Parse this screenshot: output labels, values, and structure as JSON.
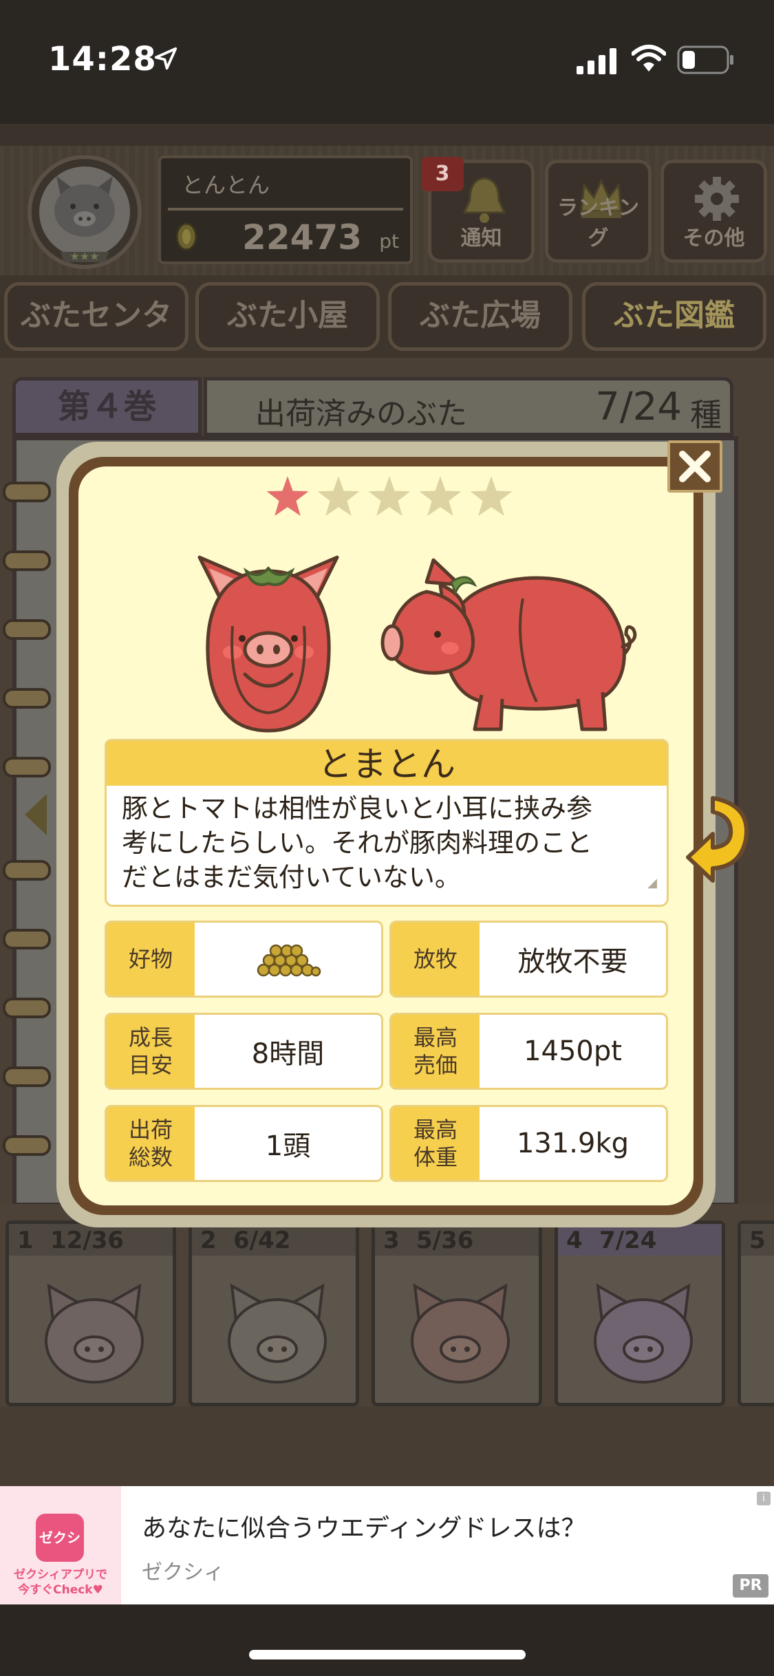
{
  "status_bar": {
    "time": "14:28"
  },
  "user": {
    "name": "とんとん",
    "points": "22473",
    "points_unit": "pt"
  },
  "header_buttons": {
    "notice": {
      "label": "通知",
      "badge": "3"
    },
    "ranking": {
      "label": "ランキング"
    },
    "other": {
      "label": "その他"
    }
  },
  "nav_tabs": [
    "ぶたセンター",
    "ぶた小屋",
    "ぶた広場",
    "ぶた図鑑"
  ],
  "volume": {
    "label": "第４巻",
    "title": "出荷済みのぶた",
    "count": "7/24",
    "unit": "種"
  },
  "pig_detail": {
    "rarity_max": 5,
    "rarity": 1,
    "name": "とまとん",
    "description_lines": [
      "豚とトマトは相性が良いと小耳に挟み参",
      "考にしたらしい。それが豚肉料理のこと",
      "だとはまだ気付いていない。"
    ],
    "stats": {
      "favorite": {
        "label": "好物",
        "value_icon": "grain-pile-icon"
      },
      "grazing": {
        "label": "放牧",
        "value": "放牧不要"
      },
      "growth": {
        "label_1": "成長",
        "label_2": "目安",
        "value": "8時間"
      },
      "max_price": {
        "label_1": "最高",
        "label_2": "売価",
        "value": "1450pt"
      },
      "shipped": {
        "label_1": "出荷",
        "label_2": "総数",
        "value": "1頭"
      },
      "max_weight": {
        "label_1": "最高",
        "label_2": "体重",
        "value": "131.9kg"
      }
    }
  },
  "volumes_shelf": [
    {
      "num": "1",
      "count": "12/36"
    },
    {
      "num": "2",
      "count": "6/42"
    },
    {
      "num": "3",
      "count": "5/36"
    },
    {
      "num": "4",
      "count": "7/24"
    },
    {
      "num": "5",
      "count": ""
    }
  ],
  "ad": {
    "title": "あなたに似合うウエディングドレスは？",
    "advertiser": "ゼクシィ",
    "thumb_logo": "ゼクシィ",
    "thumb_line_1": "ゼクシィアプリで",
    "thumb_line_2": "今すぐCheck",
    "badge": "PR",
    "info": "i"
  },
  "colors": {
    "card_bg": "#fffbcc",
    "label_yellow": "#f6cf4e",
    "pig_red": "#d9544e",
    "frame_brown": "#6a4a2b"
  }
}
